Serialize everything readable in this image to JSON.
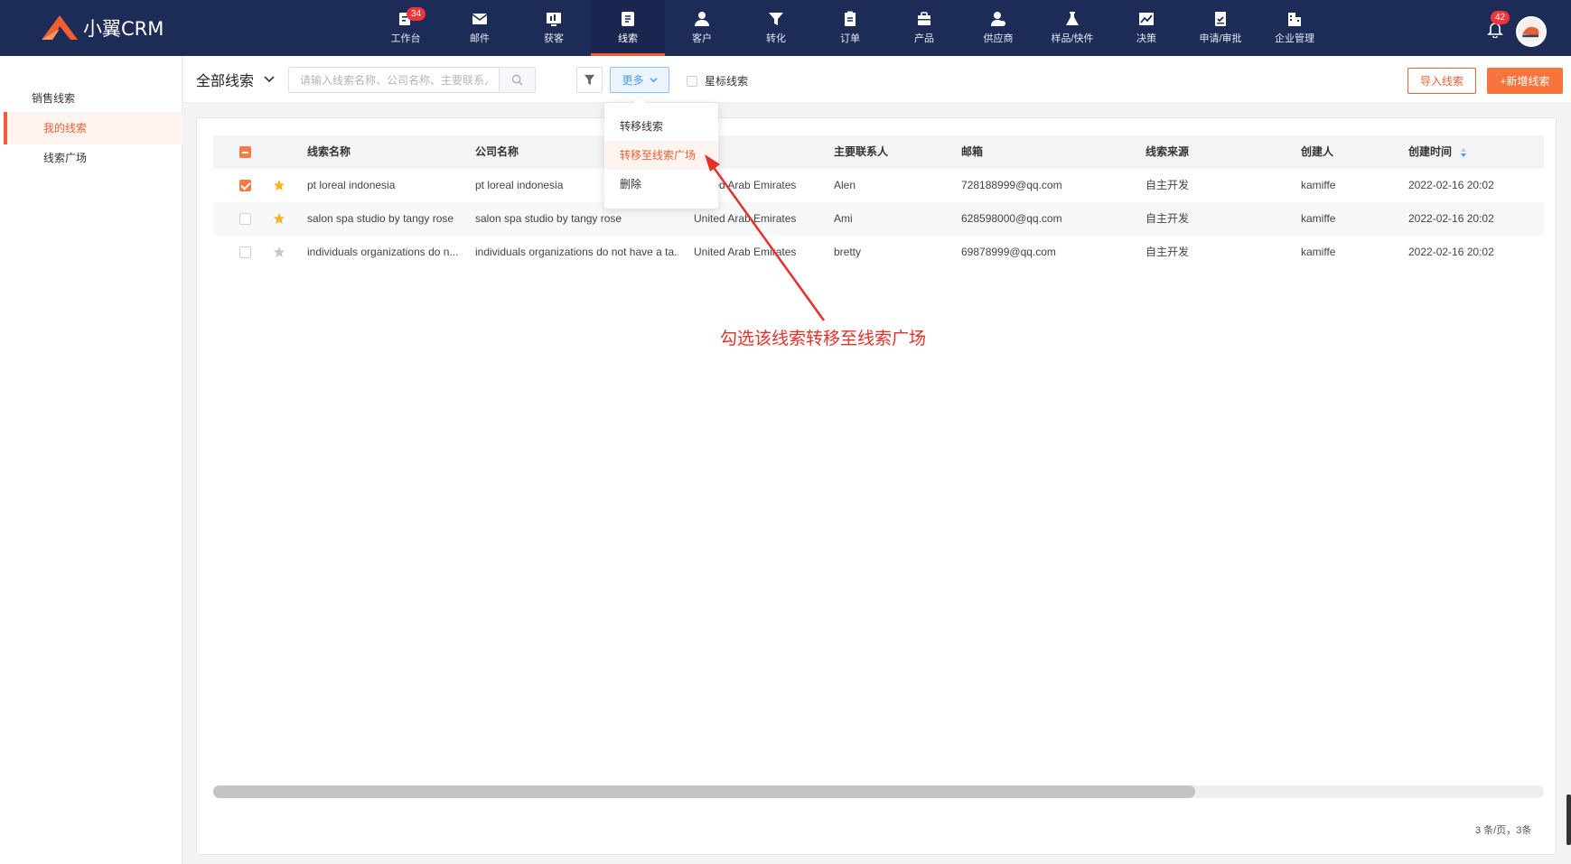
{
  "brand": {
    "name": "小翼CRM",
    "accent": "#f25e30",
    "nav_bg": "#1d2b57"
  },
  "nav": [
    {
      "label": "工作台",
      "icon": "workbench-icon",
      "badge": "34"
    },
    {
      "label": "邮件",
      "icon": "mail-icon"
    },
    {
      "label": "获客",
      "icon": "acquire-icon"
    },
    {
      "label": "线索",
      "icon": "leads-icon",
      "active": true
    },
    {
      "label": "客户",
      "icon": "customer-icon"
    },
    {
      "label": "转化",
      "icon": "funnel-icon"
    },
    {
      "label": "订单",
      "icon": "order-icon"
    },
    {
      "label": "产品",
      "icon": "product-icon"
    },
    {
      "label": "供应商",
      "icon": "supplier-icon"
    },
    {
      "label": "样品/快件",
      "icon": "sample-icon"
    },
    {
      "label": "决策",
      "icon": "decision-icon"
    },
    {
      "label": "申请/审批",
      "icon": "approval-icon"
    },
    {
      "label": "企业管理",
      "icon": "company-icon"
    }
  ],
  "header": {
    "notification_count": "42"
  },
  "sidebar": {
    "group": "销售线索",
    "items": [
      {
        "label": "我的线索",
        "active": true
      },
      {
        "label": "线索广场"
      }
    ]
  },
  "toolbar": {
    "view": "全部线索",
    "search_placeholder": "请输入线索名称、公司名称、主要联系人、邮箱",
    "more_label": "更多",
    "starred_label": "星标线索",
    "import_label": "导入线索",
    "new_label": "+新增线索"
  },
  "dropdown": {
    "items": [
      "转移线索",
      "转移至线索广场",
      "删除"
    ]
  },
  "table": {
    "columns": [
      "线索名称",
      "公司名称",
      "",
      "主要联系人",
      "邮箱",
      "线索来源",
      "创建人",
      "创建时间"
    ],
    "rows": [
      {
        "checked": true,
        "starred": true,
        "name": "pt loreal indonesia",
        "company": "pt loreal indonesia",
        "country": "United Arab Emirates",
        "contact": "Alen",
        "email": "728188999@qq.com",
        "source": "自主开发",
        "creator": "kamiffe",
        "created": "2022-02-16 20:02"
      },
      {
        "checked": false,
        "starred": true,
        "name": "salon spa studio by tangy rose",
        "company": "salon spa studio by tangy rose",
        "country": "United Arab Emirates",
        "contact": "Ami",
        "email": "628598000@qq.com",
        "source": "自主开发",
        "creator": "kamiffe",
        "created": "2022-02-16 20:02"
      },
      {
        "checked": false,
        "starred": false,
        "name": "individuals organizations do n...",
        "company": "individuals organizations do not have a ta...",
        "country": "United Arab Emirates",
        "contact": "bretty",
        "email": "69878999@qq.com",
        "source": "自主开发",
        "creator": "kamiffe",
        "created": "2022-02-16 20:02"
      }
    ],
    "pager": "3 条/页，3条"
  },
  "annotation": {
    "text": "勾选该线索转移至线索广场",
    "color": "#e8302a"
  }
}
